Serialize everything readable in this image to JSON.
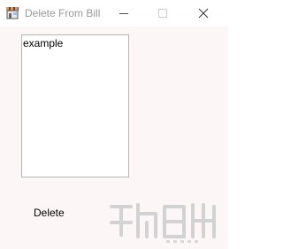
{
  "window": {
    "title": "Delete From Bill",
    "app_icon": "store-icon",
    "controls": {
      "minimize_icon": "minimize-icon",
      "maximize_icon": "maximize-icon",
      "close_icon": "close-icon"
    }
  },
  "listbox": {
    "items": [
      "example"
    ]
  },
  "actions": {
    "delete_label": "Delete"
  },
  "colors": {
    "client_background": "#fcf6f6",
    "title_text": "#999999",
    "listbox_border": "#b4b4b4",
    "watermark": "#c8c8c8"
  }
}
